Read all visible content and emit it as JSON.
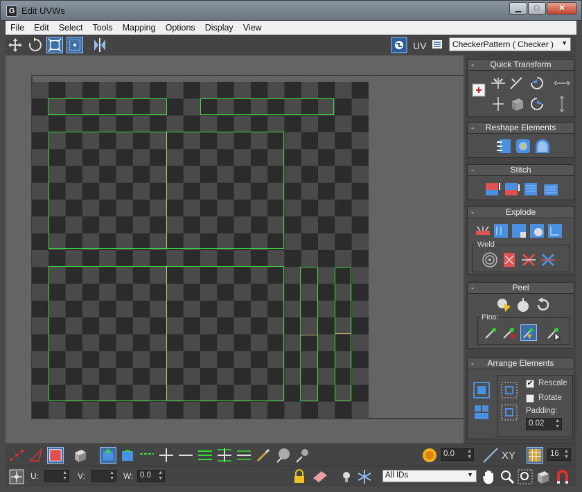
{
  "window": {
    "title": "Edit UVWs",
    "minimize": "▁",
    "maximize": "□",
    "close": "✕",
    "app_icon": "3ds-max-icon"
  },
  "menu": [
    "File",
    "Edit",
    "Select",
    "Tools",
    "Mapping",
    "Options",
    "Display",
    "View"
  ],
  "toolbar": {
    "uv_label": "UV",
    "map_select": "CheckerPattern  ( Checker )"
  },
  "rollouts": {
    "quick_transform": "Quick Transform",
    "reshape": "Reshape Elements",
    "stitch": "Stitch",
    "explode": "Explode",
    "weld": "Weld",
    "peel": "Peel",
    "pins": "Pins:",
    "arrange": "Arrange Elements",
    "rescale": "Rescale",
    "rotate": "Rotate",
    "padding_label": "Padding:",
    "padding_value": "0.02",
    "rescale_checked": true,
    "rotate_checked": false
  },
  "bottom": {
    "soft_value": "0.0",
    "xy_label": "XY",
    "grid_value": "16",
    "u_label": "U:",
    "v_label": "V:",
    "w_label": "W:",
    "w_value": "0.0",
    "ids_select": "All IDs"
  },
  "colors": {
    "uv_shell": "#3cd83c",
    "seam": "#d8c070",
    "accent": "#3d6ea8"
  }
}
